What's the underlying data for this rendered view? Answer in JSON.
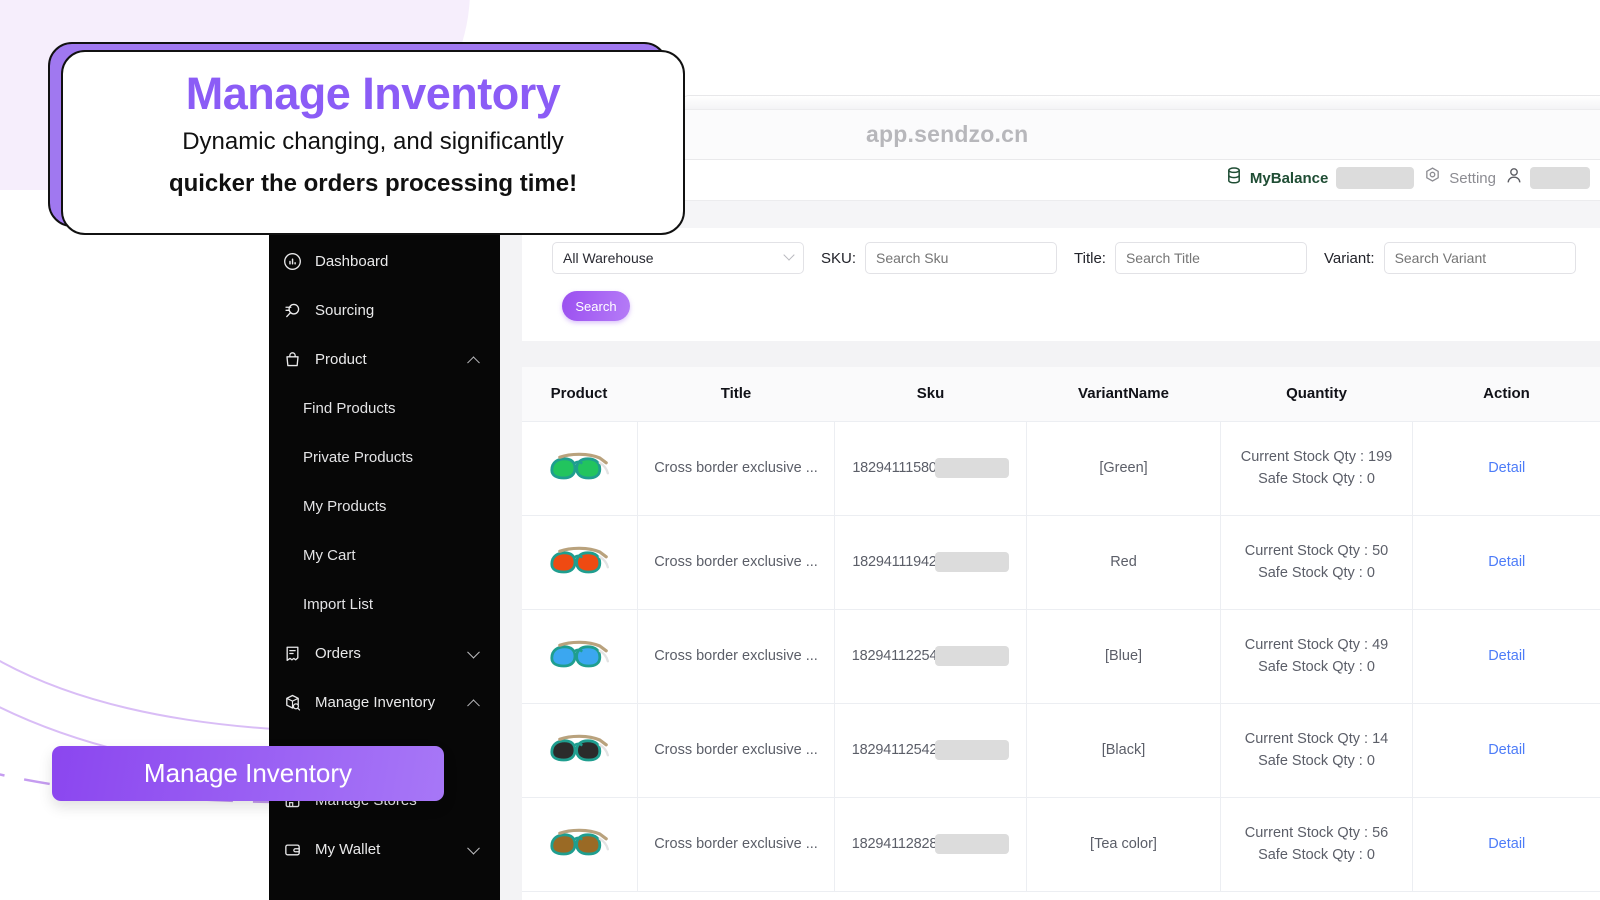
{
  "callout": {
    "title": "Manage Inventory",
    "subtitle_line1": "Dynamic changing, and significantly",
    "subtitle_line2": "quicker the orders processing time!",
    "accent_color": "#8b5cf6"
  },
  "badge": {
    "label": "Manage Inventory",
    "color": "#8b46ef"
  },
  "browser": {
    "url": "app.sendzo.cn"
  },
  "header": {
    "balance_label": "MyBalance",
    "balance_value": "",
    "balance_color": "#1f4d34",
    "setting_label": "Setting",
    "setting_color": "#8c8c92",
    "user_value": ""
  },
  "sidebar": {
    "items": [
      {
        "label": "Dashboard",
        "icon": "dashboard-icon",
        "type": "item",
        "chevron": ""
      },
      {
        "label": "Sourcing",
        "icon": "search-list-icon",
        "type": "item",
        "chevron": ""
      },
      {
        "label": "Product",
        "icon": "bag-icon",
        "type": "item",
        "chevron": "up"
      },
      {
        "label": "Find Products",
        "icon": "",
        "type": "sub",
        "chevron": ""
      },
      {
        "label": "Private Products",
        "icon": "",
        "type": "sub",
        "chevron": ""
      },
      {
        "label": "My Products",
        "icon": "",
        "type": "sub",
        "chevron": ""
      },
      {
        "label": "My Cart",
        "icon": "",
        "type": "sub",
        "chevron": ""
      },
      {
        "label": "Import List",
        "icon": "",
        "type": "sub",
        "chevron": ""
      },
      {
        "label": "Orders",
        "icon": "receipt-icon",
        "type": "item",
        "chevron": "down"
      },
      {
        "label": "Manage Inventory",
        "icon": "box-search-icon",
        "type": "item",
        "chevron": "up"
      },
      {
        "label": "Manage Stores",
        "icon": "store-icon",
        "type": "item",
        "chevron": ""
      },
      {
        "label": "My Wallet",
        "icon": "wallet-icon",
        "type": "item",
        "chevron": "down"
      }
    ]
  },
  "filters": {
    "warehouse_value": "All Warehouse",
    "sku_label": "SKU:",
    "sku_placeholder": "Search Sku",
    "title_label": "Title:",
    "title_placeholder": "Search Title",
    "variant_label": "Variant:",
    "variant_placeholder": "Search Variant",
    "search_button": "Search"
  },
  "table": {
    "columns": [
      "Product",
      "Title",
      "Sku",
      "VariantName",
      "Quantity",
      "Action"
    ],
    "rows": [
      {
        "title": "Cross border exclusive ...",
        "sku": "18294111580",
        "sku_masked": true,
        "variant": "[Green]",
        "current_stock_label": "Current Stock Qty : 199",
        "safe_stock_label": "Safe Stock Qty : 0",
        "action": "Detail",
        "lens_color": "#22c45e",
        "frame_color": "#1f9e8f"
      },
      {
        "title": "Cross border exclusive ...",
        "sku": "18294111942",
        "sku_masked": true,
        "variant": "Red",
        "current_stock_label": "Current Stock Qty : 50",
        "safe_stock_label": "Safe Stock Qty : 0",
        "action": "Detail",
        "lens_color": "#ef4a12",
        "frame_color": "#1f9e8f"
      },
      {
        "title": "Cross border exclusive ...",
        "sku": "18294112254",
        "sku_masked": true,
        "variant": "[Blue]",
        "current_stock_label": "Current Stock Qty : 49",
        "safe_stock_label": "Safe Stock Qty : 0",
        "action": "Detail",
        "lens_color": "#3ba7f0",
        "frame_color": "#1f9e8f"
      },
      {
        "title": "Cross border exclusive ...",
        "sku": "18294112542",
        "sku_masked": true,
        "variant": "[Black]",
        "current_stock_label": "Current Stock Qty : 14",
        "safe_stock_label": "Safe Stock Qty : 0",
        "action": "Detail",
        "lens_color": "#2b2b2b",
        "frame_color": "#1f9e8f"
      },
      {
        "title": "Cross border exclusive ...",
        "sku": "18294112828",
        "sku_masked": true,
        "variant": "[Tea color]",
        "current_stock_label": "Current Stock Qty : 56",
        "safe_stock_label": "Safe Stock Qty : 0",
        "action": "Detail",
        "lens_color": "#9a6a25",
        "frame_color": "#1f9e8f"
      }
    ]
  }
}
